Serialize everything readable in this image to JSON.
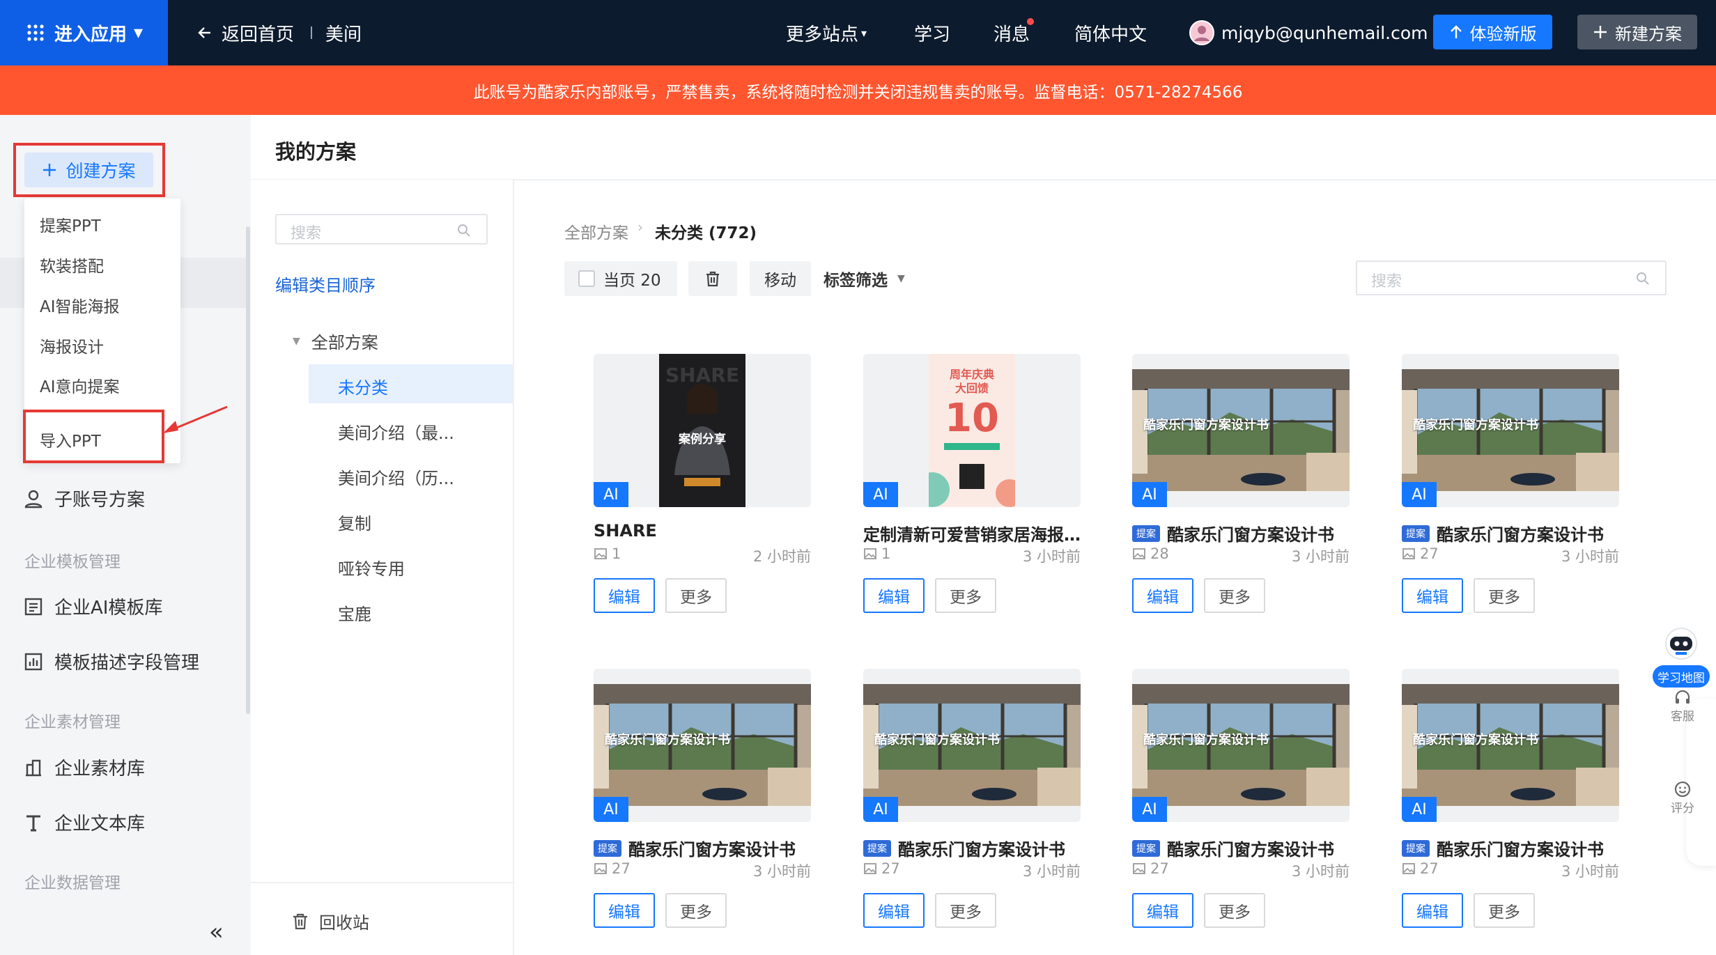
{
  "topbar": {
    "app_entry": "进入应用",
    "back_home": "返回首页",
    "site_name": "美间",
    "more_sites": "更多站点",
    "learn": "学习",
    "messages": "消息",
    "language": "简体中文",
    "user_email": "mjqyb@qunhemail.com",
    "try_new": "体验新版",
    "new_plan": "新建方案",
    "colors": {
      "bar": "#0d1b2e",
      "accent": "#1677ff",
      "notice": "#ff5630"
    }
  },
  "notice": "此账号为酷家乐内部账号，严禁售卖，系统将随时检测并关闭违规售卖的账号。监督电话：0571-28274566",
  "sidebar": {
    "create_button": "创建方案",
    "dropdown": [
      "提案PPT",
      "软装搭配",
      "AI智能海报",
      "海报设计",
      "AI意向提案"
    ],
    "import_ppt": "导入PPT",
    "sub_account": "子账号方案",
    "groups": {
      "template_mgmt": "企业模板管理",
      "material_mgmt": "企业素材管理",
      "data_mgmt": "企业数据管理"
    },
    "items": {
      "ai_template_lib": "企业AI模板库",
      "template_fields": "模板描述字段管理",
      "material_lib": "企业素材库",
      "text_lib": "企业文本库"
    },
    "collapse": "«"
  },
  "page_title": "我的方案",
  "categories": {
    "search_placeholder": "搜索",
    "edit_order": "编辑类目顺序",
    "all_root": "全部方案",
    "list": [
      "未分类",
      "美间介绍（最...",
      "美间介绍（历...",
      "复制",
      "哑铃专用",
      "宝鹿"
    ],
    "recycle": "回收站"
  },
  "main": {
    "breadcrumb_root": "全部方案",
    "breadcrumb_current": "未分类 (772)",
    "select_page": "当页 20",
    "move": "移动",
    "tag_filter": "标签筛选",
    "search_placeholder": "搜索",
    "edit_label": "编辑",
    "more_label": "更多",
    "ai_badge": "AI",
    "tag_label": "提案",
    "cover_title": "酷家乐门窗方案设计书",
    "share_case": "案例分享",
    "poster_line1": "周年庆典",
    "poster_line2": "大回馈",
    "poster_num": "10",
    "cards": [
      {
        "title": "SHARE",
        "count": "1",
        "time": "2 小时前",
        "tagged": false,
        "thumb": "share"
      },
      {
        "title": "定制清新可爱营销家居海报...",
        "count": "1",
        "time": "3 小时前",
        "tagged": false,
        "thumb": "poster"
      },
      {
        "title": "酷家乐门窗方案设计书",
        "count": "28",
        "time": "3 小时前",
        "tagged": true,
        "thumb": "room"
      },
      {
        "title": "酷家乐门窗方案设计书",
        "count": "27",
        "time": "3 小时前",
        "tagged": true,
        "thumb": "room"
      },
      {
        "title": "酷家乐门窗方案设计书",
        "count": "27",
        "time": "3 小时前",
        "tagged": true,
        "thumb": "room"
      },
      {
        "title": "酷家乐门窗方案设计书",
        "count": "27",
        "time": "3 小时前",
        "tagged": true,
        "thumb": "room"
      },
      {
        "title": "酷家乐门窗方案设计书",
        "count": "27",
        "time": "3 小时前",
        "tagged": true,
        "thumb": "room"
      },
      {
        "title": "酷家乐门窗方案设计书",
        "count": "27",
        "time": "3 小时前",
        "tagged": true,
        "thumb": "room"
      }
    ]
  },
  "float": {
    "learn_map": "学习地图",
    "service": "客服",
    "rate": "评分"
  }
}
